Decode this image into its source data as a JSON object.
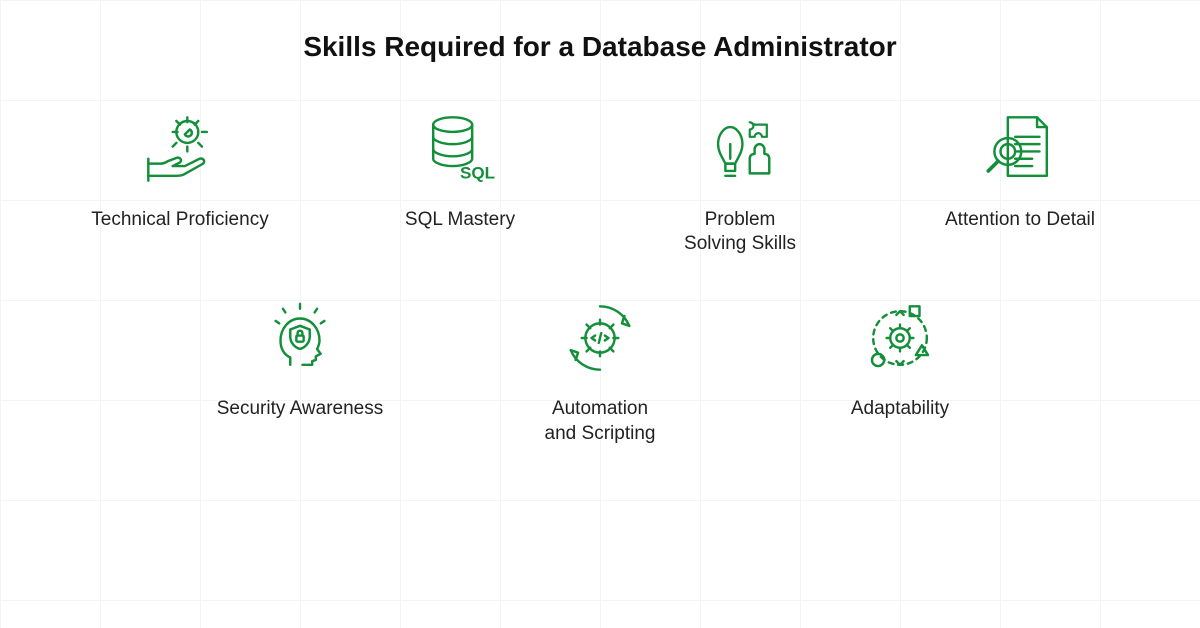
{
  "title": "Skills Required for a\nDatabase Administrator",
  "accent": "#138f3a",
  "skills": {
    "row1": [
      {
        "label": "Technical Proficiency",
        "icon": "hand-gear-icon"
      },
      {
        "label": "SQL Mastery",
        "icon": "database-sql-icon"
      },
      {
        "label": "Problem\nSolving Skills",
        "icon": "bulb-puzzle-icon"
      },
      {
        "label": "Attention to Detail",
        "icon": "document-magnify-icon"
      }
    ],
    "row2": [
      {
        "label": "Security Awareness",
        "icon": "head-shield-icon"
      },
      {
        "label": "Automation\nand Scripting",
        "icon": "gear-cycle-icon"
      },
      {
        "label": "Adaptability",
        "icon": "gear-shapes-icon"
      }
    ]
  }
}
